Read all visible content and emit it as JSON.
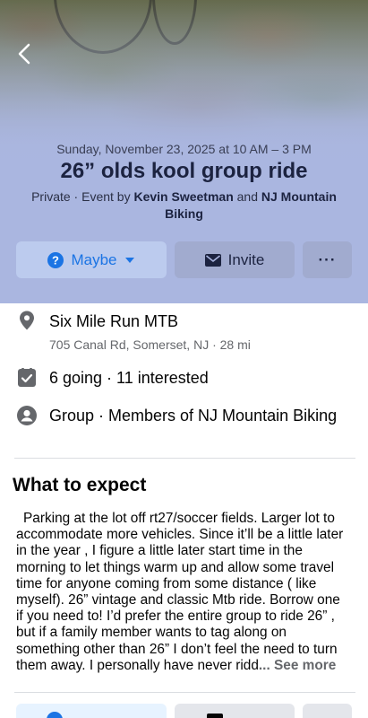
{
  "event": {
    "date": "Sunday, November 23, 2025 at 10 AM – 3 PM",
    "title": "26” olds kool group ride",
    "host_prefix": "Private · Event by ",
    "host_1": "Kevin Sweetman",
    "host_and": " and ",
    "host_2": "NJ Mountain Biking"
  },
  "actions": {
    "maybe_label": "Maybe",
    "invite_label": "Invite",
    "more_label": "···"
  },
  "info": {
    "location_name": "Six Mile Run MTB",
    "location_address": "705 Canal Rd, Somerset, NJ · 28 mi",
    "attendance": "6 going · 11 interested",
    "privacy": "Group · Members of NJ Mountain Biking"
  },
  "details": {
    "heading": "What to expect",
    "description": "Parking at the lot off rt27/soccer fields. Larger lot to accommodate more vehicles. Since it’ll be a little later in the year , I figure a little later start time in the morning to let things warm up and allow some travel time for anyone coming from some distance ( like myself).  26” vintage and classic Mtb ride. Borrow one if you need to!  I’d prefer the entire group to ride 26” , but if a family member wants to tag along on something other than 26” I don’t feel the need to turn them away. I personally have never ridd",
    "see_more": "... See more"
  },
  "colors": {
    "accent": "#1b74e4",
    "hero_bg": "#aab6e0"
  }
}
